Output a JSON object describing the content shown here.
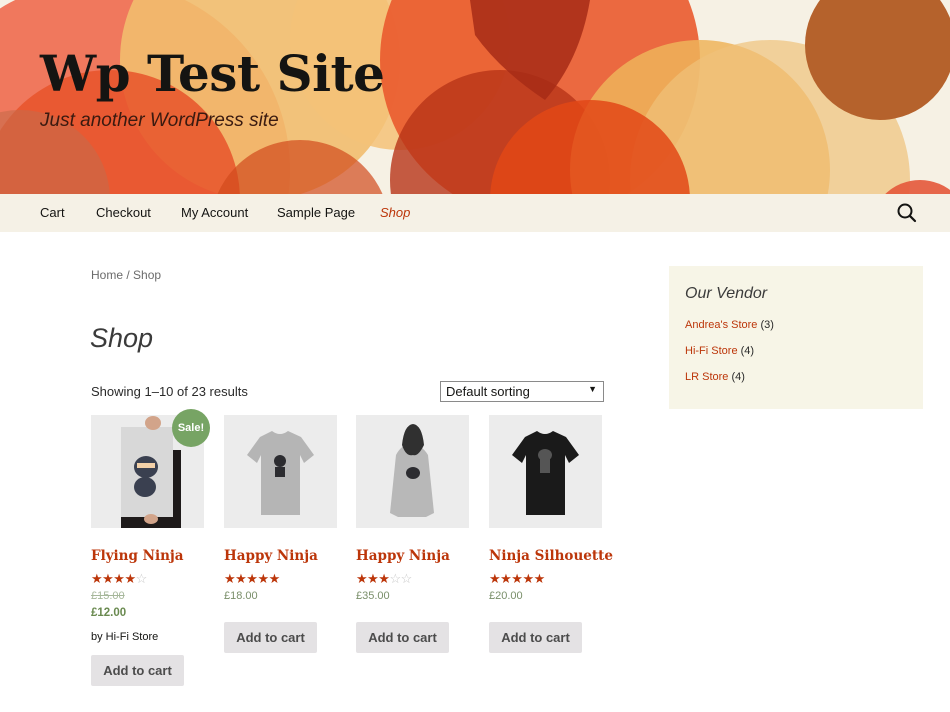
{
  "header": {
    "site_title": "Wp Test Site",
    "site_description": "Just another WordPress site"
  },
  "nav": {
    "items": [
      {
        "label": "Cart",
        "active": false
      },
      {
        "label": "Checkout",
        "active": false
      },
      {
        "label": "My Account",
        "active": false
      },
      {
        "label": "Sample Page",
        "active": false
      },
      {
        "label": "Shop",
        "active": true
      }
    ],
    "search_icon": "search-icon"
  },
  "breadcrumb": {
    "home": "Home",
    "separator": " / ",
    "current": "Shop"
  },
  "page": {
    "title": "Shop",
    "result_count": "Showing 1–10 of 23 results",
    "ordering": {
      "selected": "Default sorting",
      "caret": "▼"
    }
  },
  "products": [
    {
      "name": "Flying Ninja",
      "rating": 4,
      "max_rating": 5,
      "regular_price": "£15.00",
      "sale_price": "£12.00",
      "on_sale": true,
      "sale_badge": "Sale!",
      "vendor": "by Hi-Fi Store",
      "button": "Add to cart",
      "image": "ninja-poster"
    },
    {
      "name": "Happy Ninja",
      "rating": 5,
      "max_rating": 5,
      "price": "£18.00",
      "on_sale": false,
      "button": "Add to cart",
      "image": "grey-tshirt"
    },
    {
      "name": "Happy Ninja",
      "rating": 3,
      "max_rating": 5,
      "price": "£35.00",
      "on_sale": false,
      "button": "Add to cart",
      "image": "grey-hoodie"
    },
    {
      "name": "Ninja Silhouette",
      "rating": 5,
      "max_rating": 5,
      "price": "£20.00",
      "on_sale": false,
      "button": "Add to cart",
      "image": "black-tshirt"
    }
  ],
  "sidebar": {
    "widget_title": "Our Vendor",
    "vendors": [
      {
        "name": "Andrea's Store",
        "count": "(3)"
      },
      {
        "name": "Hi-Fi Store",
        "count": "(4)"
      },
      {
        "name": "LR Store",
        "count": "(4)"
      }
    ]
  },
  "colors": {
    "accent": "#bc360a",
    "nav_bg": "#f5f1e6",
    "sidebar_bg": "#f7f5e7",
    "sale_badge": "#77a464",
    "price": "#7a8f6a",
    "button_bg": "#e4e2e4"
  }
}
